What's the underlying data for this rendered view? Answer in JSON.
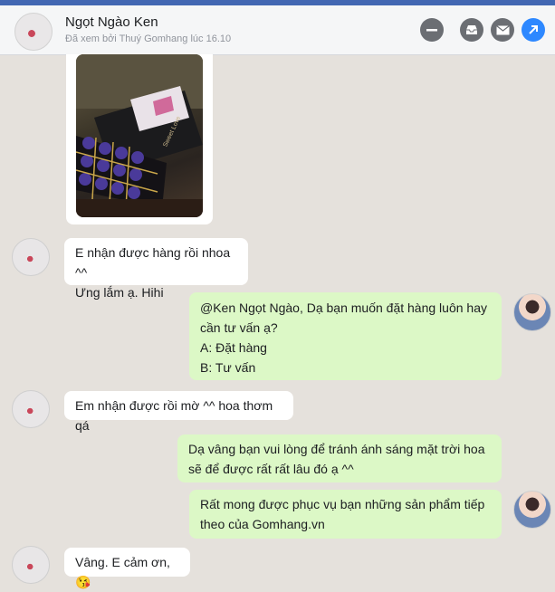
{
  "header": {
    "name": "Ngọt Ngào Ken",
    "seen": "Đã xem bởi Thuý Gomhang lúc 16.10"
  },
  "messages": [
    {
      "side": "in",
      "lines": [
        "E nhận được hàng rồi nhoa ^^",
        "Ưng lắm ạ. Hihi"
      ]
    },
    {
      "side": "out",
      "lines": [
        "@Ken Ngọt Ngào, Dạ bạn muốn đặt hàng luôn hay",
        "cần tư vấn ạ?",
        "A: Đặt hàng",
        "B: Tư vấn"
      ]
    },
    {
      "side": "in",
      "lines": [
        "Em nhận được rồi mờ ^^ hoa thơm qá"
      ]
    },
    {
      "side": "out",
      "lines": [
        "Dạ vâng bạn vui lòng để tránh ánh sáng mặt trời hoa",
        "sẽ để được rất rất lâu đó ạ ^^"
      ]
    },
    {
      "side": "out",
      "lines": [
        "Rất mong được phục vụ bạn những sản phẩm tiếp",
        "theo của Gomhang.vn"
      ]
    },
    {
      "side": "in",
      "lines": [
        "Vâng. E cảm ơn, 😘"
      ]
    }
  ],
  "photo": {
    "box_text": "Sweet Love"
  },
  "colors": {
    "incoming": "#ffffff",
    "outgoing": "#dcf8c6",
    "background": "#e5e1dc",
    "accent": "#2d88ff"
  }
}
